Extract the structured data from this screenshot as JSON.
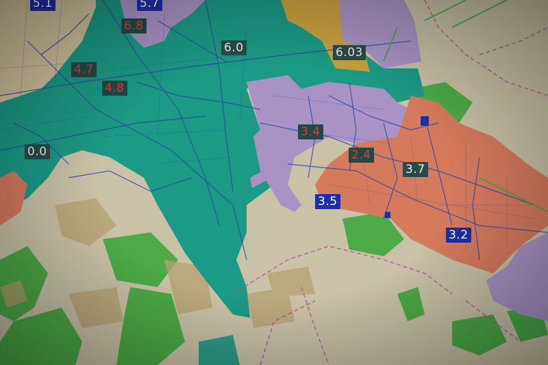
{
  "map": {
    "colors": {
      "background": "#c9c2a6",
      "teal_zone": "#1b9a85",
      "violet_zone": "#a893c4",
      "salmon_zone": "#d67a5e",
      "ochre_zone": "#c8a040",
      "park_green": "#3fa83d",
      "road_blue": "#2b48a8",
      "boundary_magenta": "#b04aa0"
    },
    "labels": [
      {
        "id": "label-1",
        "text": "5.1",
        "style": "blue"
      },
      {
        "id": "label-2",
        "text": "5.7",
        "style": "blue"
      },
      {
        "id": "label-3",
        "text": "6.8",
        "style": "red"
      },
      {
        "id": "label-4",
        "text": "6.0",
        "style": "dark"
      },
      {
        "id": "label-5",
        "text": "6.03",
        "style": "dark"
      },
      {
        "id": "label-6",
        "text": "4.7",
        "style": "red"
      },
      {
        "id": "label-7",
        "text": "4.8",
        "style": "red"
      },
      {
        "id": "label-8",
        "text": "0.0",
        "style": "dark"
      },
      {
        "id": "label-9",
        "text": "3.4",
        "style": "red"
      },
      {
        "id": "label-10",
        "text": "2.4",
        "style": "red"
      },
      {
        "id": "label-11",
        "text": "3.7",
        "style": "dark"
      },
      {
        "id": "label-12",
        "text": "3.5",
        "style": "blue"
      },
      {
        "id": "label-13",
        "text": "3.2",
        "style": "blue"
      }
    ],
    "style_colors": {
      "blue": {
        "bg": "#1f2da8",
        "fg": "#ffffff"
      },
      "red": {
        "bg": "#1f4a48",
        "fg": "#e63a2a"
      },
      "dark": {
        "bg": "#2a4a48",
        "fg": "#e8f0ec"
      }
    }
  }
}
